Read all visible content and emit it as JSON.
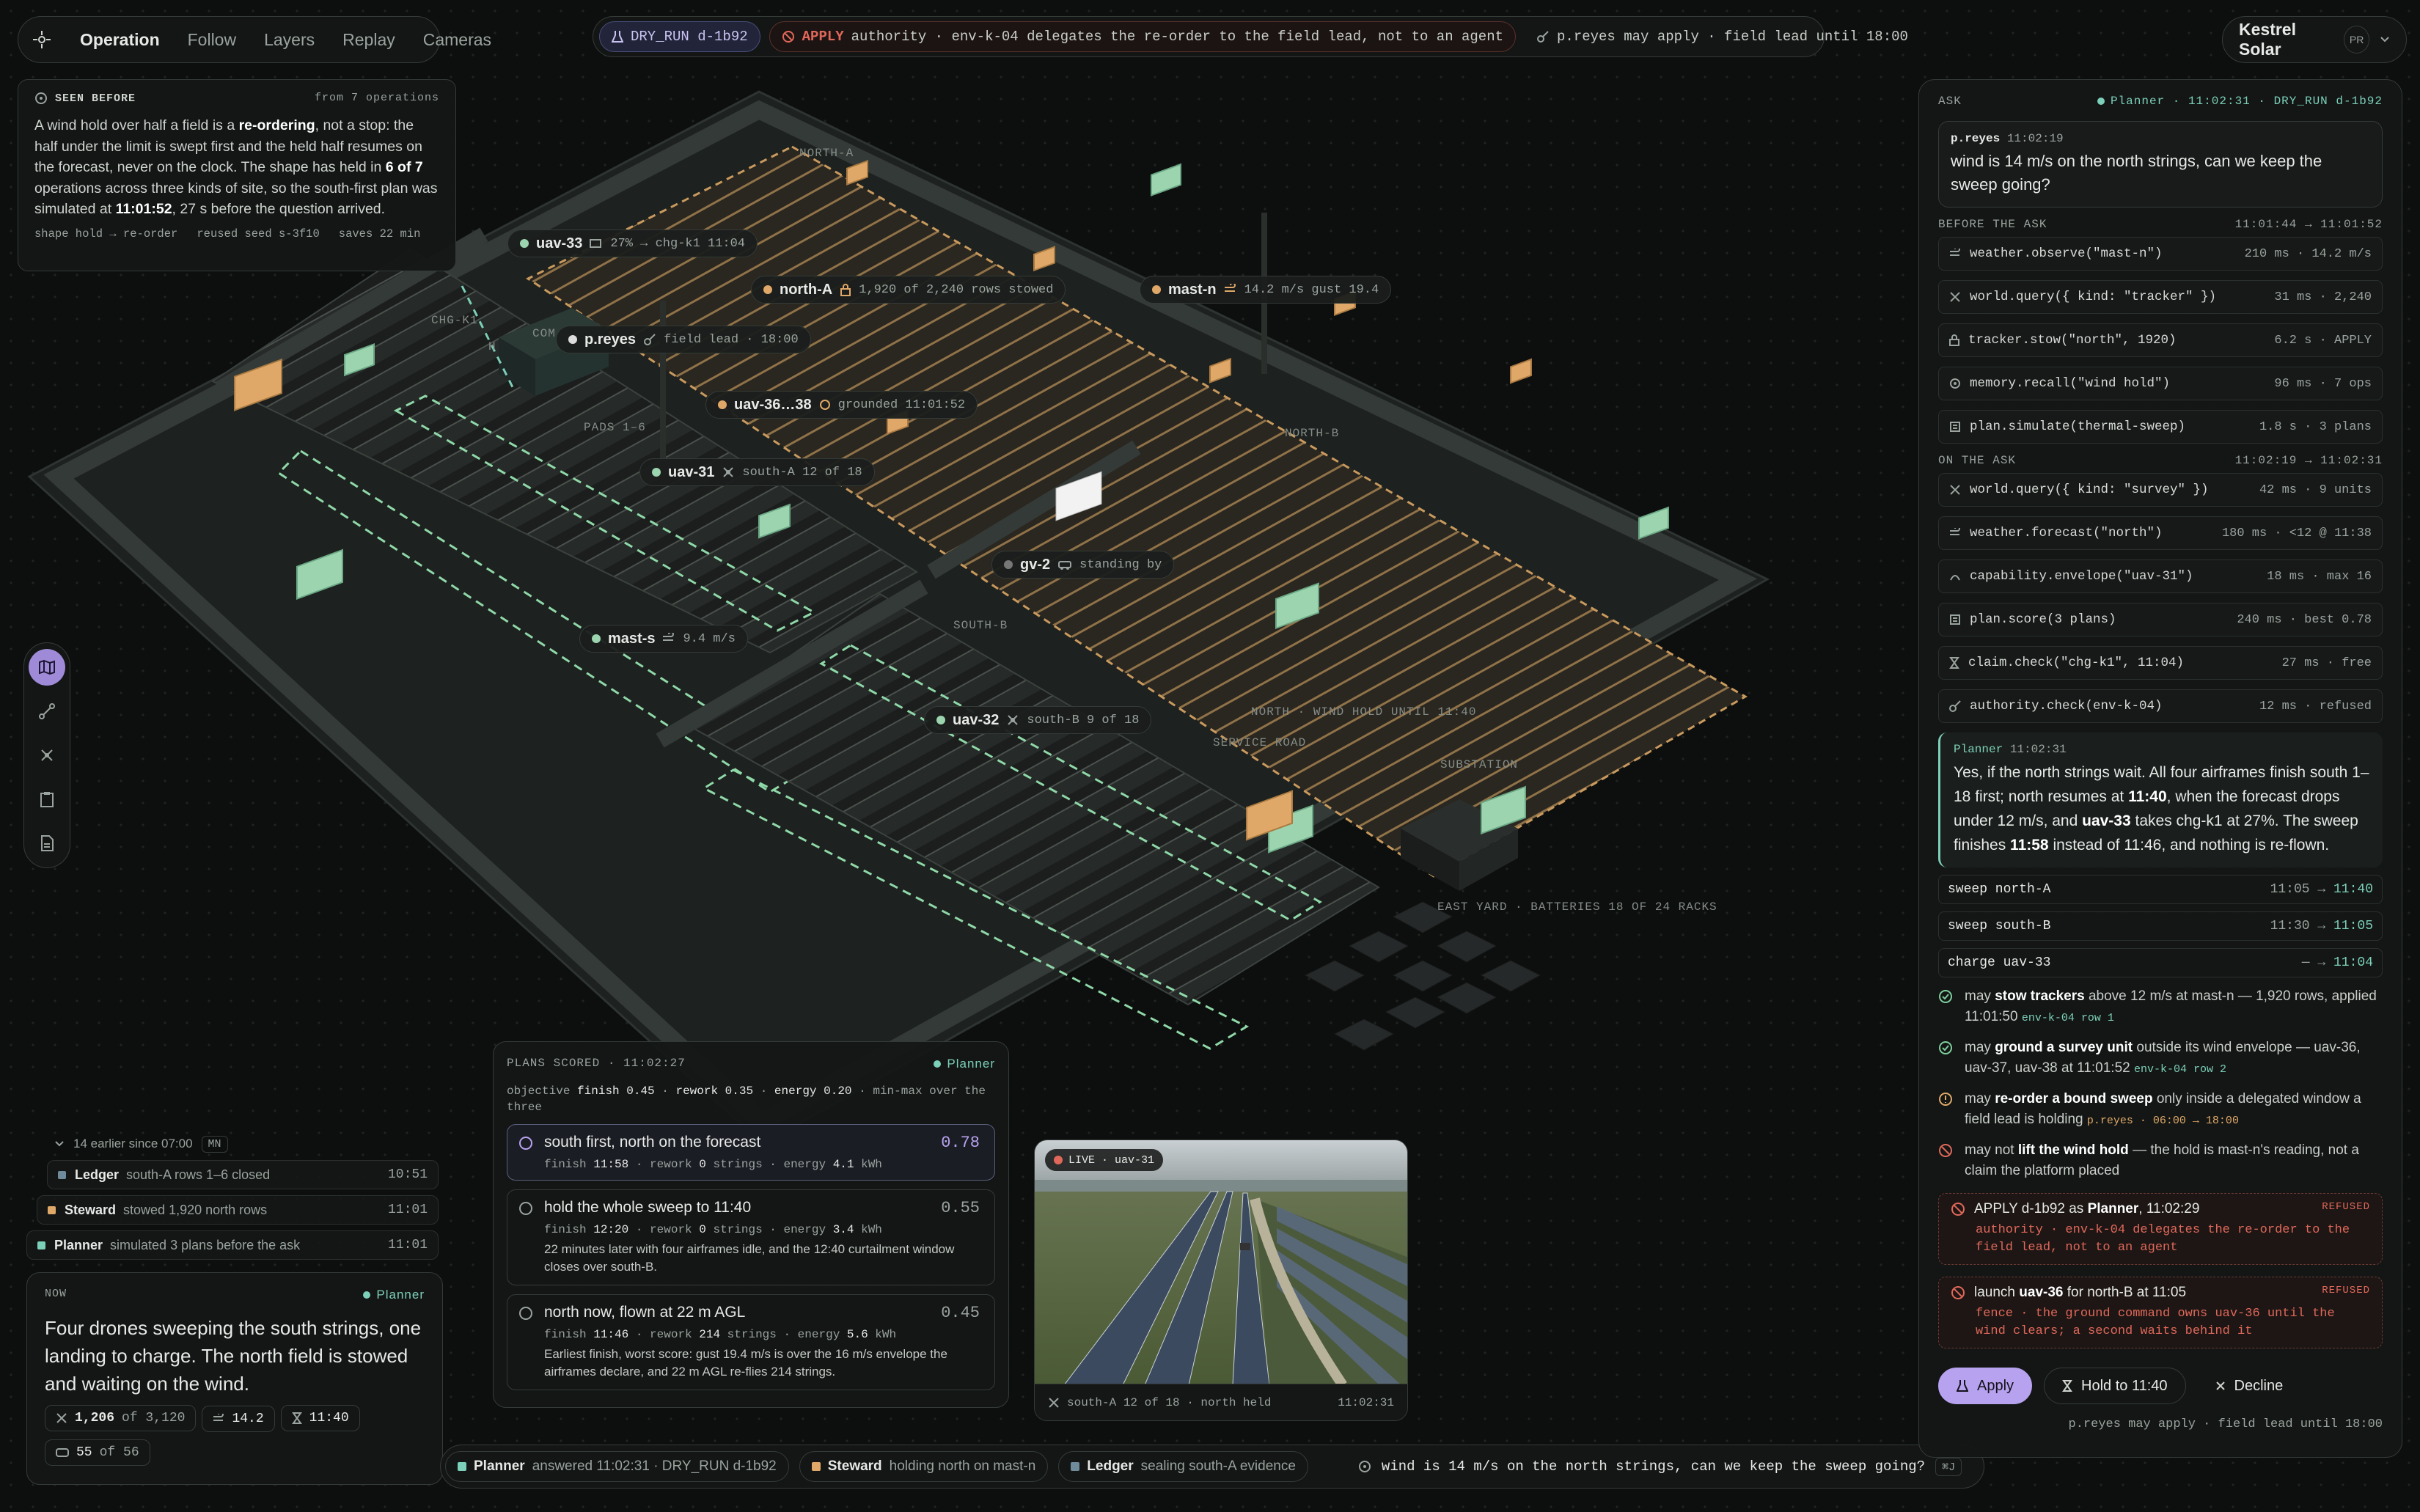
{
  "nav": {
    "tabs": [
      "Operation",
      "Follow",
      "Layers",
      "Replay",
      "Cameras"
    ]
  },
  "status": {
    "mode": "DRY_RUN d-1b92",
    "apply_label": "APPLY",
    "apply_text": "authority · env-k-04 delegates the re-order to the field lead, not to an agent",
    "permit": "p.reyes may apply · field lead until 18:00"
  },
  "brand": {
    "name": "Kestrel Solar",
    "initials": "PR"
  },
  "seen_before": {
    "title": "SEEN BEFORE",
    "source": "from 7 operations",
    "p1": "A wind hold over half a field is a",
    "p1b": "re-ordering",
    "p2": ", not a stop: the half under the limit is swept first and the held half resumes on the forecast, never on the clock. The shape has held in",
    "p2b": "6 of 7",
    "p3": "operations across three kinds of site, so the south-first plan was simulated at",
    "p3b": "11:01:52",
    "p4": ", 27 s before the question arrived.",
    "f_shape": "shape hold → re-order",
    "f_seed": "reused seed s-3f10",
    "f_saves": "saves 22 min"
  },
  "map_labels": {
    "uav33": {
      "name": "uav-33",
      "sub": "27% → chg-k1 11:04"
    },
    "northA": {
      "name": "north-A",
      "sub": "1,920 of 2,240 rows stowed"
    },
    "mastn": {
      "name": "mast-n",
      "sub": "14.2 m/s gust 19.4"
    },
    "preyes": {
      "name": "p.reyes",
      "sub": "field lead · 18:00"
    },
    "uav3638": {
      "name": "uav-36…38",
      "sub": "grounded 11:01:52"
    },
    "uav31": {
      "name": "uav-31",
      "sub": "south-A 12 of 18"
    },
    "gv2": {
      "name": "gv-2",
      "sub": "standing by"
    },
    "masts": {
      "name": "mast-s",
      "sub": "9.4 m/s"
    },
    "uav32": {
      "name": "uav-32",
      "sub": "south-B 9 of 18"
    }
  },
  "zones": {
    "northA": "NORTH-A",
    "northB": "NORTH-B",
    "chg": "CHG-K1",
    "pads": "PADS 1–6",
    "southB": "SOUTH-B",
    "hold": "NORTH · WIND HOLD UNTIL 11:40",
    "service": "SERVICE ROAD",
    "substation": "SUBSTATION",
    "eastyard": "EAST YARD · BATTERIES 18 OF 24 RACKS",
    "com": "COM",
    "h": "H"
  },
  "feed": {
    "earlier": "14 earlier since 07:00",
    "earlier_key": "MN",
    "rows": [
      {
        "who": "Ledger",
        "text": "south-A rows 1–6 closed",
        "time": "10:51",
        "color": "#6f8a9a"
      },
      {
        "who": "Steward",
        "text": "stowed 1,920 north rows",
        "time": "11:01",
        "color": "#e0a868"
      },
      {
        "who": "Planner",
        "text": "simulated 3 plans before the ask",
        "time": "11:01",
        "color": "#7ccfb8"
      }
    ]
  },
  "now": {
    "title": "NOW",
    "agent": "Planner",
    "text": "Four drones sweeping the south strings, one landing to charge. The north field is stowed and waiting on the wind.",
    "s1": "1,206",
    "s1b": "of 3,120",
    "s2": "14.2",
    "s3": "11:40",
    "s4": "55",
    "s4b": "of 56"
  },
  "plans": {
    "title": "PLANS SCORED · 11:02:27",
    "agent": "Planner",
    "obj_prefix": "objective",
    "obj_finish": "finish 0.45",
    "obj_rework": "rework 0.35",
    "obj_energy": "energy 0.20",
    "obj_suffix": "· min-max over the three",
    "items": [
      {
        "title": "south first, north on the forecast",
        "score": "0.78",
        "finish": "11:58",
        "rework": "0",
        "energy": "4.1",
        "desc": ""
      },
      {
        "title": "hold the whole sweep to 11:40",
        "score": "0.55",
        "finish": "12:20",
        "rework": "0",
        "energy": "3.4",
        "desc": "22 minutes later with four airframes idle, and the 12:40 curtailment window closes over south-B."
      },
      {
        "title": "north now, flown at 22 m AGL",
        "score": "0.45",
        "finish": "11:46",
        "rework": "214",
        "energy": "5.6",
        "desc": "Earliest finish, worst score: gust 19.4 m/s is over the 16 m/s envelope the airframes declare, and 22 m AGL re-flies 214 strings."
      }
    ]
  },
  "live": {
    "tag": "LIVE · uav-31",
    "caption": "south-A 12 of 18 · north held",
    "time": "11:02:31"
  },
  "bottom": {
    "planner": "Planner",
    "planner_txt": "answered 11:02:31 · DRY_RUN d-1b92",
    "steward": "Steward",
    "steward_txt": "holding north on mast-n",
    "ledger": "Ledger",
    "ledger_txt": "sealing south-A evidence",
    "ask": "wind is 14 m/s on the north strings, can we keep the sweep going?",
    "kbd": "⌘J"
  },
  "ask_panel": {
    "title": "ASK",
    "meta": "Planner · 11:02:31 · DRY_RUN d-1b92",
    "q_who": "p.reyes",
    "q_time": "11:02:19",
    "q_text": "wind is 14 m/s on the north strings, can we keep the sweep going?",
    "before_title": "BEFORE THE ASK",
    "before_range": "11:01:44 → 11:01:52",
    "before": [
      {
        "call": "weather.observe(\"mast-n\")",
        "res": "210 ms · 14.2 m/s",
        "icon": "wind-icon"
      },
      {
        "call": "world.query({ kind: \"tracker\" })",
        "res": "31 ms · 2,240",
        "icon": "query-icon"
      },
      {
        "call": "tracker.stow(\"north\", 1920)",
        "res": "6.2 s · APPLY",
        "icon": "lock-icon"
      },
      {
        "call": "memory.recall(\"wind hold\")",
        "res": "96 ms · 7 ops",
        "icon": "memory-icon"
      },
      {
        "call": "plan.simulate(thermal-sweep)",
        "res": "1.8 s · 3 plans",
        "icon": "plan-icon"
      }
    ],
    "on_title": "ON THE ASK",
    "on_range": "11:02:19 → 11:02:31",
    "on": [
      {
        "call": "world.query({ kind: \"survey\" })",
        "res": "42 ms · 9 units",
        "icon": "query-icon"
      },
      {
        "call": "weather.forecast(\"north\")",
        "res": "180 ms · <12 @ 11:38",
        "icon": "wind-icon"
      },
      {
        "call": "capability.envelope(\"uav-31\")",
        "res": "18 ms · max 16",
        "icon": "envelope-icon"
      },
      {
        "call": "plan.score(3 plans)",
        "res": "240 ms · best 0.78",
        "icon": "plan-icon"
      },
      {
        "call": "claim.check(\"chg-k1\", 11:04)",
        "res": "27 ms · free",
        "icon": "hourglass-icon"
      },
      {
        "call": "authority.check(env-k-04)",
        "res": "12 ms · refused",
        "icon": "key-icon"
      }
    ],
    "ans_who": "Planner",
    "ans_time": "11:02:31",
    "ans_1": "Yes, if the north strings wait. All four airframes finish south 1–18 first; north resumes at",
    "ans_b1": "11:40",
    "ans_2": ", when the forecast drops under 12 m/s, and",
    "ans_b2": "uav-33",
    "ans_3": "takes chg-k1 at 27%. The sweep finishes",
    "ans_b3": "11:58",
    "ans_4": "instead of 11:46, and nothing is re-flown.",
    "schedule": [
      {
        "name": "sweep north-A",
        "from": "11:05",
        "to": "11:40"
      },
      {
        "name": "sweep south-B",
        "from": "11:30",
        "to": "11:05"
      },
      {
        "name": "charge uav-33",
        "from": "—",
        "to": "11:04"
      }
    ],
    "perms": [
      {
        "pre": "may",
        "b": "stow trackers",
        "post": "above 12 m/s at mast-n — 1,920 rows, applied 11:01:50",
        "sub": "env-k-04 row 1",
        "kind": "ok"
      },
      {
        "pre": "may",
        "b": "ground a survey unit",
        "post": "outside its wind envelope — uav-36, uav-37, uav-38 at 11:01:52",
        "sub": "env-k-04 row 2",
        "kind": "ok"
      },
      {
        "pre": "may",
        "b": "re-order a bound sweep",
        "post": "only inside a delegated window a field lead is holding",
        "sub": "p.reyes · 06:00 → 18:00",
        "kind": "warn"
      },
      {
        "pre": "may not",
        "b": "lift the wind hold",
        "post": "— the hold is mast-n's reading, not a claim the platform placed",
        "sub": "",
        "kind": "no"
      }
    ],
    "ref1_pre": "APPLY d-1b92 as",
    "ref1_b": "Planner",
    "ref1_post": ", 11:02:29",
    "ref1_tag": "REFUSED",
    "ref1_d": "authority · env-k-04 delegates the re-order to the field lead, not to an agent",
    "ref2_pre": "launch",
    "ref2_b": "uav-36",
    "ref2_post": "for north-B at 11:05",
    "ref2_tag": "REFUSED",
    "ref2_d": "fence · the ground command owns uav-36 until the wind clears; a second waits behind it",
    "apply": "Apply",
    "hold": "Hold to 11:40",
    "decline": "Decline",
    "foot": "p.reyes may apply · field lead until 18:00"
  }
}
